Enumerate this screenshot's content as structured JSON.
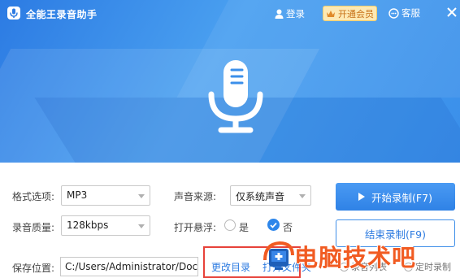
{
  "app": {
    "title": "全能王录音助手"
  },
  "titlebar": {
    "login_label": "登录",
    "vip_label": "开通会员",
    "service_label": "客服"
  },
  "form": {
    "format_label": "格式选项:",
    "format_value": "MP3",
    "quality_label": "录音质量:",
    "quality_value": "128kbps",
    "source_label": "声音来源:",
    "source_value": "仅系统声音",
    "float_label": "打开悬浮:",
    "float_option_yes": "是",
    "float_option_no": "否",
    "float_selected": "否",
    "save_label": "保存位置:",
    "save_path": "C:/Users/Administrator/Docu"
  },
  "actions": {
    "start_label": "开始录制(F7)",
    "stop_label": "结束录制(F9)",
    "change_dir_label": "更改目录",
    "open_folder_label": "打开文件夹",
    "record_list_label": "录音列表",
    "timer_label": "定时录制"
  },
  "watermark": {
    "text": "电脑技术吧"
  },
  "colors": {
    "accent": "#2d86ea",
    "highlight": "#e7423a",
    "watermark": "#f15b22",
    "vip_bg": "#fde9b4"
  },
  "icons": [
    "app-logo-icon",
    "user-icon",
    "crown-icon",
    "headset-icon",
    "close-icon",
    "microphone-icon",
    "play-icon",
    "radio-checked-icon"
  ]
}
